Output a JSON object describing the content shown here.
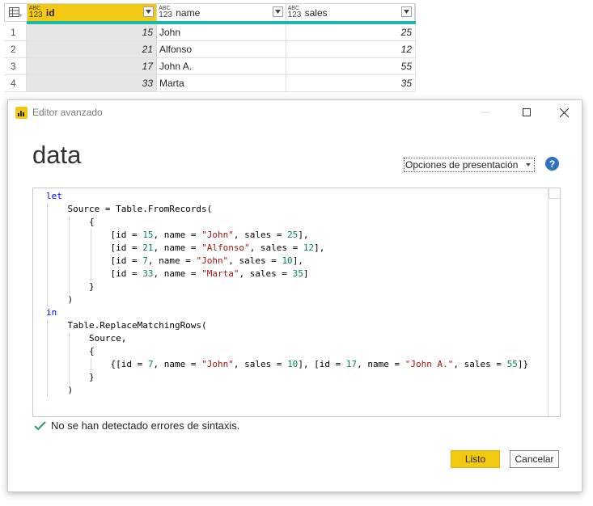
{
  "grid": {
    "columns": [
      {
        "type_top": "ABC",
        "type_bottom": "123",
        "name": "id"
      },
      {
        "type_top": "ABC",
        "type_bottom": "123",
        "name": "name"
      },
      {
        "type_top": "ABC",
        "type_bottom": "123",
        "name": "sales"
      }
    ],
    "rows": [
      {
        "n": "1",
        "id": "15",
        "name": "John",
        "sales": "25"
      },
      {
        "n": "2",
        "id": "21",
        "name": "Alfonso",
        "sales": "12"
      },
      {
        "n": "3",
        "id": "17",
        "name": "John A.",
        "sales": "55"
      },
      {
        "n": "4",
        "id": "33",
        "name": "Marta",
        "sales": "35"
      }
    ]
  },
  "dialog": {
    "window_title": "Editor avanzado",
    "query_name": "data",
    "view_options_label": "Opciones de presentación",
    "help_label": "?",
    "status_text": "No se han detectado errores de sintaxis.",
    "done_label": "Listo",
    "cancel_label": "Cancelar"
  },
  "colors": {
    "accent": "#f2c811",
    "selected_column_border": "#1eb8a6",
    "help": "#2d72c4",
    "ok_check": "#3a9b73"
  }
}
